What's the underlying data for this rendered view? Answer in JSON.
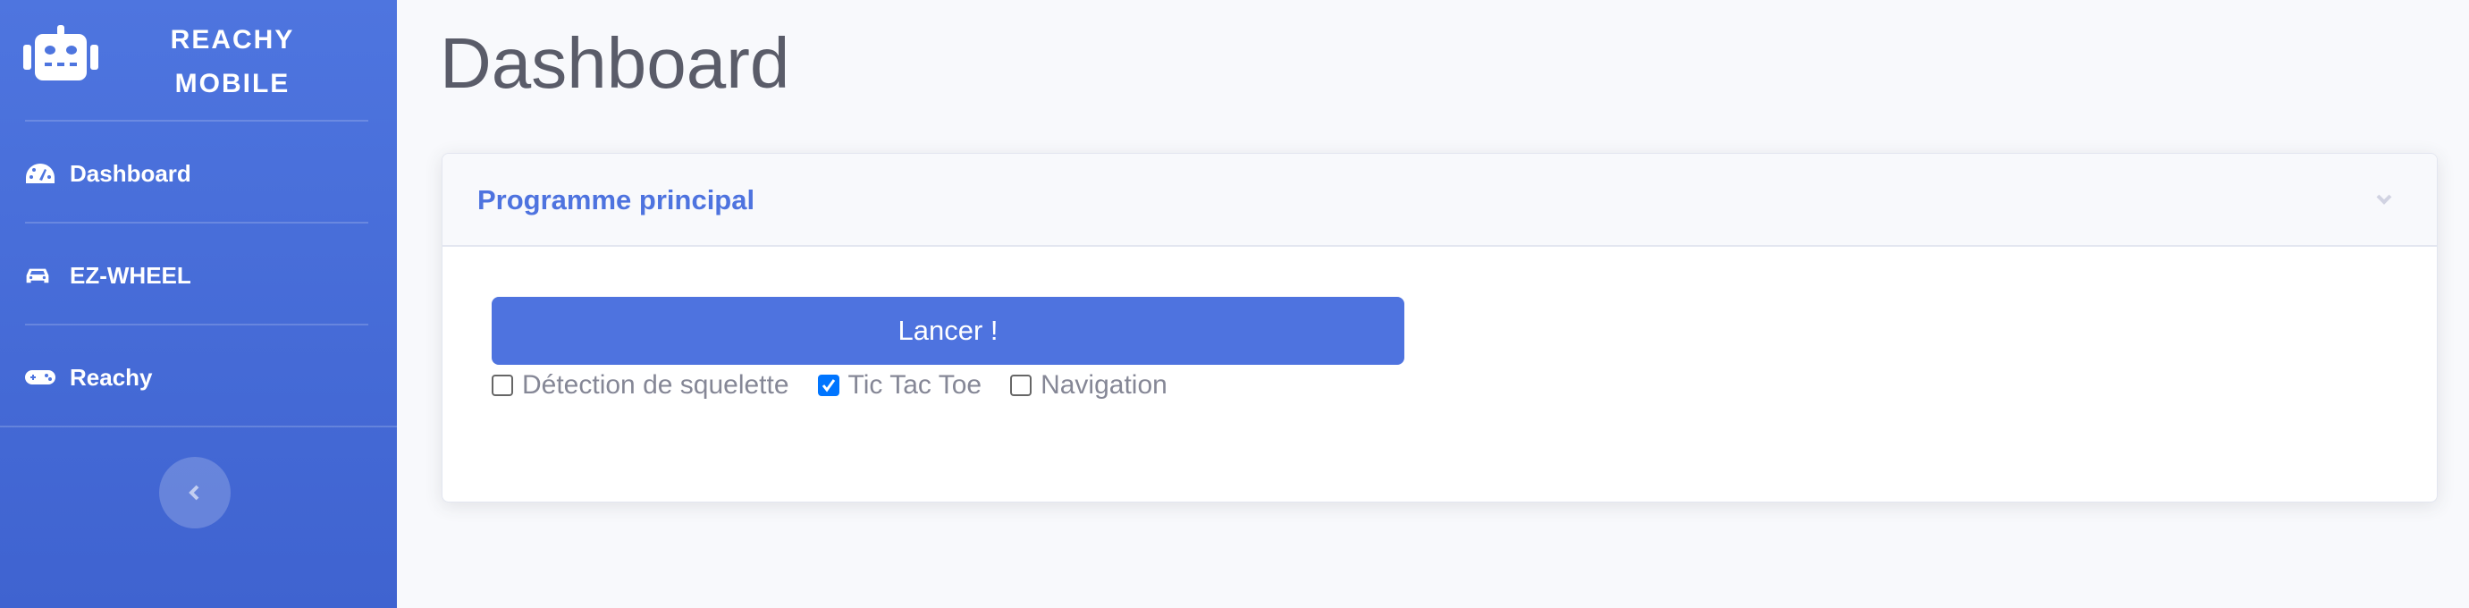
{
  "sidebar": {
    "brand": {
      "line1": "REACHY",
      "line2": "MOBILE",
      "icon": "robot-icon"
    },
    "items": [
      {
        "label": "Dashboard",
        "icon": "tachometer-icon"
      },
      {
        "label": "EZ-WHEEL",
        "icon": "car-icon"
      },
      {
        "label": "Reachy",
        "icon": "gamepad-icon"
      }
    ],
    "toggle_icon": "chevron-left-icon"
  },
  "main": {
    "title": "Dashboard",
    "card": {
      "title": "Programme principal",
      "collapse_icon": "chevron-down-icon",
      "launch_label": "Lancer !",
      "options": [
        {
          "label": "Détection de squelette",
          "checked": false
        },
        {
          "label": "Tic Tac Toe",
          "checked": true
        },
        {
          "label": "Navigation",
          "checked": false
        }
      ]
    }
  },
  "colors": {
    "primary": "#4e73df",
    "background": "#f8f9fc",
    "checkbox": "#0075ff"
  }
}
